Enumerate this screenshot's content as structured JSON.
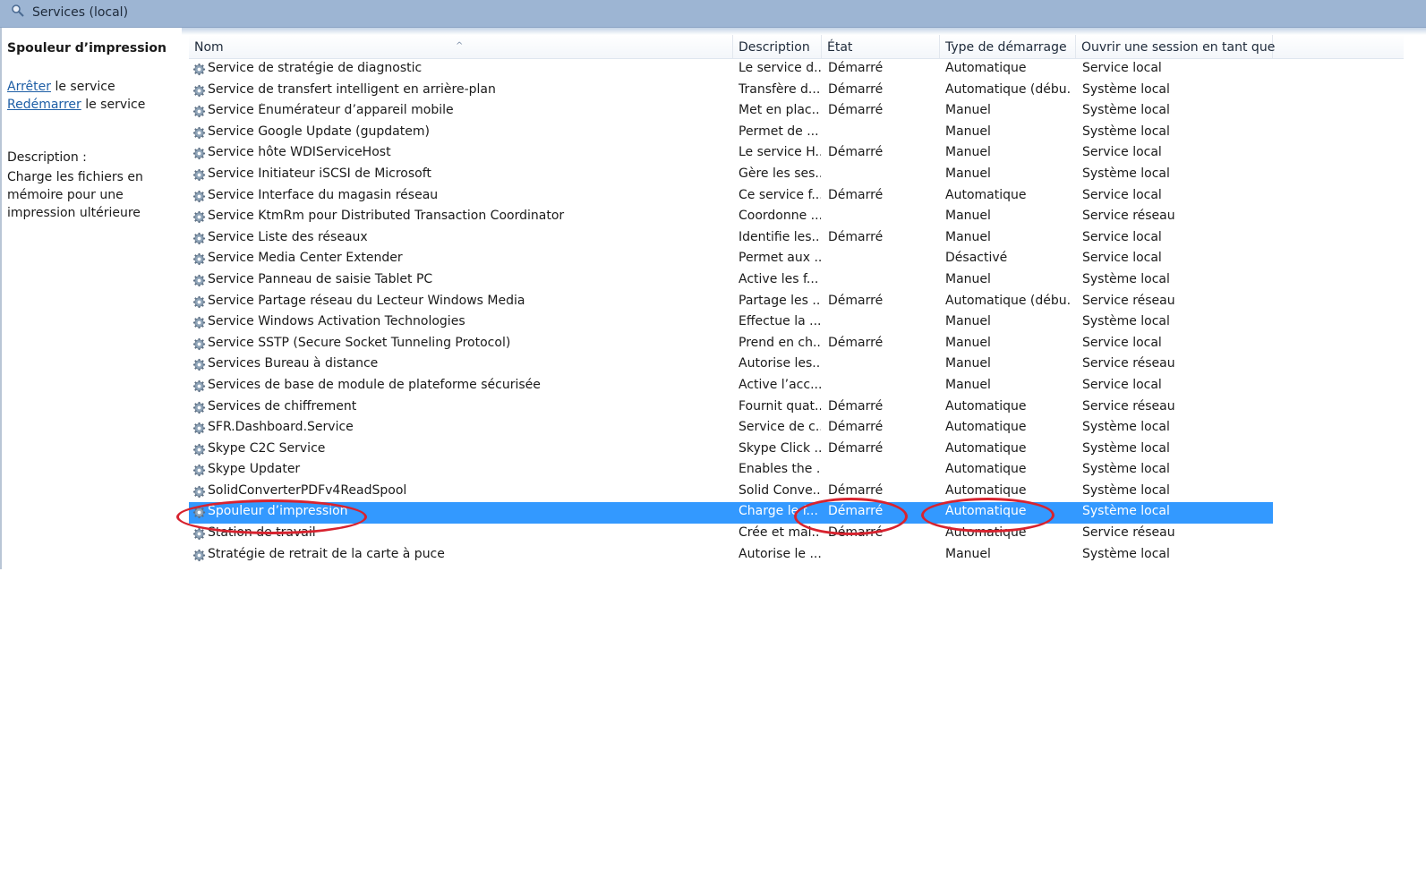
{
  "window": {
    "title": "Services (local)"
  },
  "left_panel": {
    "service_title": "Spouleur d’impression",
    "stop_link": "Arrêter",
    "stop_suffix": " le service",
    "restart_link": "Redémarrer",
    "restart_suffix": " le service",
    "description_label": "Description :",
    "description_text": "Charge les fichiers en mémoire pour une impression ultérieure"
  },
  "table": {
    "headers": {
      "name": "Nom",
      "description": "Description",
      "state": "État",
      "startup_type": "Type de démarrage",
      "logon_as": "Ouvrir une session en tant que"
    },
    "sort_indicator": "^",
    "selected_index": 21,
    "rows": [
      {
        "name": "Service de stratégie de diagnostic",
        "description": "Le service d...",
        "state": "Démarré",
        "startup_type": "Automatique",
        "logon_as": "Service local"
      },
      {
        "name": "Service de transfert intelligent en arrière-plan",
        "description": "Transfère d...",
        "state": "Démarré",
        "startup_type": "Automatique (débu...",
        "logon_as": "Système local"
      },
      {
        "name": "Service Énumérateur d’appareil mobile",
        "description": "Met en plac...",
        "state": "Démarré",
        "startup_type": "Manuel",
        "logon_as": "Système local"
      },
      {
        "name": "Service Google Update (gupdatem)",
        "description": "Permet de ...",
        "state": "",
        "startup_type": "Manuel",
        "logon_as": "Système local"
      },
      {
        "name": "Service hôte WDIServiceHost",
        "description": "Le service H...",
        "state": "Démarré",
        "startup_type": "Manuel",
        "logon_as": "Service local"
      },
      {
        "name": "Service Initiateur iSCSI de Microsoft",
        "description": "Gère les ses...",
        "state": "",
        "startup_type": "Manuel",
        "logon_as": "Système local"
      },
      {
        "name": "Service Interface du magasin réseau",
        "description": "Ce service f...",
        "state": "Démarré",
        "startup_type": "Automatique",
        "logon_as": "Service local"
      },
      {
        "name": "Service KtmRm pour Distributed Transaction Coordinator",
        "description": "Coordonne ...",
        "state": "",
        "startup_type": "Manuel",
        "logon_as": "Service réseau"
      },
      {
        "name": "Service Liste des réseaux",
        "description": "Identifie les...",
        "state": "Démarré",
        "startup_type": "Manuel",
        "logon_as": "Service local"
      },
      {
        "name": "Service Media Center Extender",
        "description": "Permet aux ...",
        "state": "",
        "startup_type": "Désactivé",
        "logon_as": "Service local"
      },
      {
        "name": "Service Panneau de saisie Tablet PC",
        "description": "Active les f...",
        "state": "",
        "startup_type": "Manuel",
        "logon_as": "Système local"
      },
      {
        "name": "Service Partage réseau du Lecteur Windows Media",
        "description": "Partage les ...",
        "state": "Démarré",
        "startup_type": "Automatique (débu...",
        "logon_as": "Service réseau"
      },
      {
        "name": "Service Windows Activation Technologies",
        "description": "Effectue la ...",
        "state": "",
        "startup_type": "Manuel",
        "logon_as": "Système local"
      },
      {
        "name": "Service SSTP (Secure Socket Tunneling Protocol)",
        "description": "Prend en ch...",
        "state": "Démarré",
        "startup_type": "Manuel",
        "logon_as": "Service local"
      },
      {
        "name": "Services Bureau à distance",
        "description": "Autorise les...",
        "state": "",
        "startup_type": "Manuel",
        "logon_as": "Service réseau"
      },
      {
        "name": "Services de base de module de plateforme sécurisée",
        "description": "Active l’acc...",
        "state": "",
        "startup_type": "Manuel",
        "logon_as": "Service local"
      },
      {
        "name": "Services de chiffrement",
        "description": "Fournit quat...",
        "state": "Démarré",
        "startup_type": "Automatique",
        "logon_as": "Service réseau"
      },
      {
        "name": "SFR.Dashboard.Service",
        "description": "Service de c...",
        "state": "Démarré",
        "startup_type": "Automatique",
        "logon_as": "Système local"
      },
      {
        "name": "Skype C2C Service",
        "description": "Skype Click ...",
        "state": "Démarré",
        "startup_type": "Automatique",
        "logon_as": "Système local"
      },
      {
        "name": "Skype Updater",
        "description": "Enables the ...",
        "state": "",
        "startup_type": "Automatique",
        "logon_as": "Système local"
      },
      {
        "name": "SolidConverterPDFv4ReadSpool",
        "description": "Solid Conve...",
        "state": "Démarré",
        "startup_type": "Automatique",
        "logon_as": "Système local"
      },
      {
        "name": "Spouleur d’impression",
        "description": "Charge le f...",
        "state": "Démarré",
        "startup_type": "Automatique",
        "logon_as": "Système local"
      },
      {
        "name": "Station de travail",
        "description": "Crée et mai...",
        "state": "Démarré",
        "startup_type": "Automatique",
        "logon_as": "Service réseau"
      },
      {
        "name": "Stratégie de retrait de la carte à puce",
        "description": "Autorise le ...",
        "state": "",
        "startup_type": "Manuel",
        "logon_as": "Système local"
      }
    ]
  },
  "colors": {
    "selection": "#3399ff",
    "annotation": "#d7232f",
    "titlebar": "#9db5d3",
    "link": "#1f5fa6"
  },
  "icons": {
    "row_icon": "gear-icon",
    "title_icon": "services-magnifier-icon"
  }
}
